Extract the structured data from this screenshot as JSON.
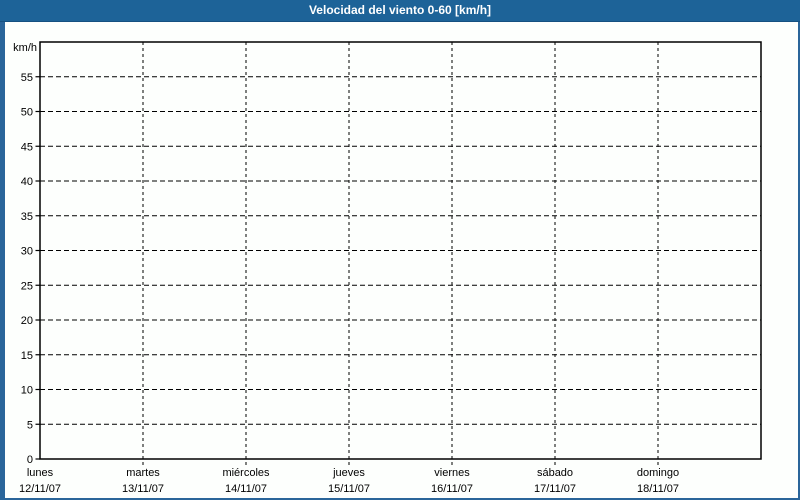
{
  "header": {
    "title": "Velocidad del viento 0-60 [km/h]"
  },
  "colors": {
    "header_bg": "#1d6398",
    "header_border": "#155181",
    "page_border": "#2a659a",
    "background": "#fdfffd",
    "grid": "#000000",
    "frame": "#000000",
    "label_text": "#000000",
    "title_text": "#ffffff"
  },
  "chart_data": {
    "type": "line",
    "title": "Velocidad del viento 0-60 [km/h]",
    "ylabel": "km/h",
    "xlabel": "",
    "ylim": [
      0,
      60
    ],
    "ytick_step": 5,
    "ytick_labels": [
      "0",
      "5",
      "10",
      "15",
      "20",
      "25",
      "30",
      "35",
      "40",
      "45",
      "50",
      "55"
    ],
    "categories": [
      {
        "day": "lunes",
        "date": "12/11/07"
      },
      {
        "day": "martes",
        "date": "13/11/07"
      },
      {
        "day": "miércoles",
        "date": "14/11/07"
      },
      {
        "day": "jueves",
        "date": "15/11/07"
      },
      {
        "day": "viernes",
        "date": "16/11/07"
      },
      {
        "day": "sábado",
        "date": "17/11/07"
      },
      {
        "day": "domingo",
        "date": "18/11/07"
      }
    ],
    "series": [],
    "grid": true,
    "legend": "none"
  }
}
